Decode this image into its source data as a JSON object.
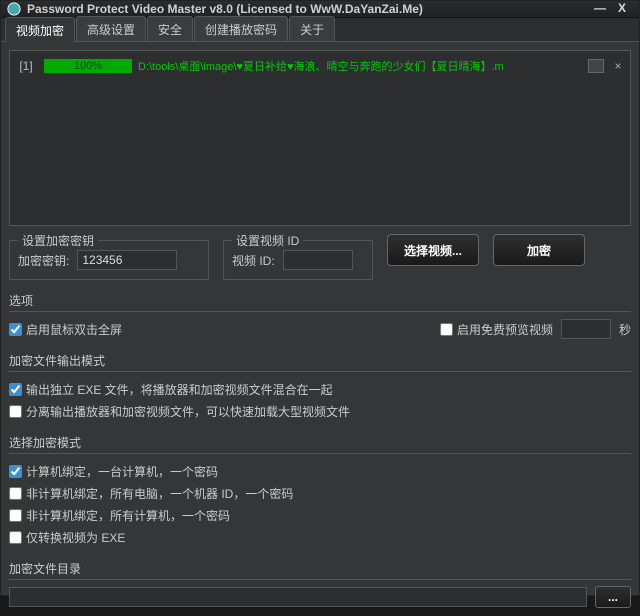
{
  "window": {
    "title": "Password Protect Video Master v8.0 (Licensed to WwW.DaYanZai.Me)"
  },
  "tabs": [
    "视频加密",
    "高级设置",
    "安全",
    "创建播放密码",
    "关于"
  ],
  "list": {
    "rows": [
      {
        "index": "[1]",
        "progress": "100%",
        "path": "D:\\tools\\桌面\\image\\♥夏日补给♥海浪、晴空与奔跑的少女们【夏日晴海】.m"
      }
    ]
  },
  "encrypt": {
    "section": "设置加密密钥",
    "keyLabel": "加密密钥:",
    "keyValue": "123456"
  },
  "videoId": {
    "section": "设置视频 ID",
    "label": "视频 ID:",
    "value": ""
  },
  "actions": {
    "select": "选择视频...",
    "encrypt": "加密"
  },
  "options": {
    "section": "选项",
    "dblFullscreen": "启用鼠标双击全屏",
    "freePreview": "启用免费预览视频",
    "seconds": "",
    "secondsUnit": "秒"
  },
  "outputMode": {
    "section": "加密文件输出模式",
    "optA": "输出独立 EXE 文件，将播放器和加密视频文件混合在一起",
    "optB": "分离输出播放器和加密视频文件，可以快速加载大型视频文件"
  },
  "encMode": {
    "section": "选择加密模式",
    "optA": "计算机绑定，一台计算机，一个密码",
    "optB": "非计算机绑定，所有电脑，一个机器 ID，一个密码",
    "optC": "非计算机绑定，所有计算机，一个密码",
    "optD": "仅转换视频为 EXE"
  },
  "outDir": {
    "section": "加密文件目录",
    "value": "",
    "browse": "..."
  }
}
